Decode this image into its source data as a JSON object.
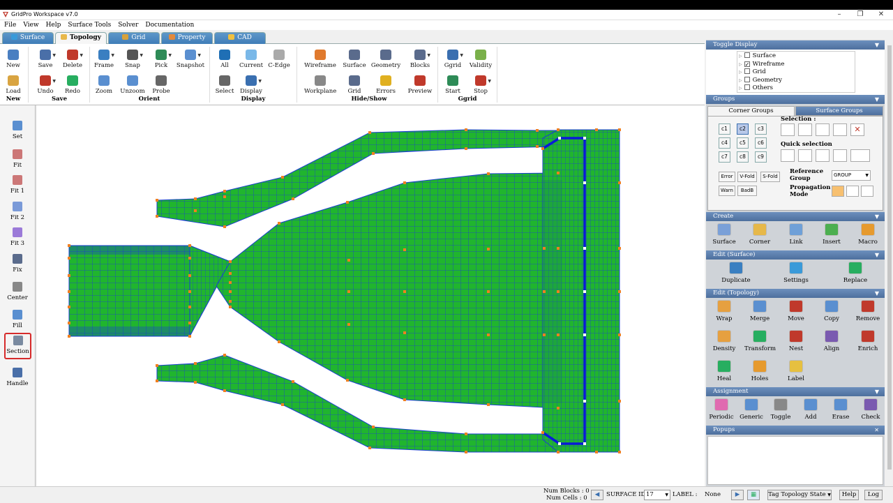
{
  "window": {
    "title": "GridPro Workspace v7.0",
    "min": "–",
    "max": "❐",
    "close": "✕"
  },
  "menu": [
    "File",
    "View",
    "Help",
    "Surface Tools",
    "Solver",
    "Documentation"
  ],
  "tabs": [
    {
      "label": "Surface",
      "color": "#3a9ad9"
    },
    {
      "label": "Topology",
      "color": "#e8b84a"
    },
    {
      "label": "Grid",
      "color": "#d9a23a"
    },
    {
      "label": "Property",
      "color": "#e2893c"
    },
    {
      "label": "CAD",
      "color": "#f0c040"
    }
  ],
  "ribbon": {
    "buttons": [
      {
        "label": "New",
        "color": "#4a7fc1"
      },
      {
        "label": "Save",
        "color": "#4a6fa8"
      },
      {
        "label": "Delete",
        "color": "#c0392b"
      },
      {
        "label": "Load",
        "color": "#d9a441"
      },
      {
        "label": "Undo",
        "color": "#c0392b"
      },
      {
        "label": "Redo",
        "color": "#27ae60"
      },
      {
        "label": "Frame",
        "color": "#3a7fc1"
      },
      {
        "label": "Snap",
        "color": "#555"
      },
      {
        "label": "Pick",
        "color": "#2e8b57"
      },
      {
        "label": "Snapshot",
        "color": "#5a8fd0"
      },
      {
        "label": "Zoom",
        "color": "#5a8fd0"
      },
      {
        "label": "Unzoom",
        "color": "#5a8fd0"
      },
      {
        "label": "Probe",
        "color": "#666"
      },
      {
        "label": "All",
        "color": "#1f6fb5"
      },
      {
        "label": "Current",
        "color": "#7ab8e8"
      },
      {
        "label": "C-Edge",
        "color": "#aaa"
      },
      {
        "label": "Select",
        "color": "#666"
      },
      {
        "label": "Display",
        "color": "#3a6fb0"
      },
      {
        "label": "Wireframe",
        "color": "#e07a2e"
      },
      {
        "label": "Surface",
        "color": "#5a6b8c"
      },
      {
        "label": "Geometry",
        "color": "#5a6b8c"
      },
      {
        "label": "Blocks",
        "color": "#5a6b8c"
      },
      {
        "label": "Workplane",
        "color": "#888"
      },
      {
        "label": "Grid",
        "color": "#5a6b8c"
      },
      {
        "label": "Errors",
        "color": "#e0b020"
      },
      {
        "label": "Preview",
        "color": "#c0392b"
      },
      {
        "label": "Ggrid",
        "color": "#3a6fb0"
      },
      {
        "label": "Validity",
        "color": "#7ab04a"
      },
      {
        "label": "Start",
        "color": "#2e8b57"
      },
      {
        "label": "Stop",
        "color": "#c0392b"
      }
    ],
    "groups": [
      "New",
      "Save",
      "Orient",
      "Display",
      "Hide/Show",
      "Ggrid"
    ]
  },
  "left_toolbar": [
    {
      "label": "Set"
    },
    {
      "label": "Fit"
    },
    {
      "label": "Fit 1"
    },
    {
      "label": "Fit 2"
    },
    {
      "label": "Fit 3"
    },
    {
      "label": "Fix"
    },
    {
      "label": "Center"
    },
    {
      "label": "Fill"
    },
    {
      "label": "Section"
    },
    {
      "label": "Handle"
    }
  ],
  "right_panel": {
    "toggle_display": {
      "title": "Toggle Display",
      "items": [
        {
          "label": "Surface",
          "checked": false
        },
        {
          "label": "Wireframe",
          "checked": true
        },
        {
          "label": "Grid",
          "checked": false
        },
        {
          "label": "Geometry",
          "checked": false
        },
        {
          "label": "Others",
          "checked": false
        }
      ]
    },
    "groups": {
      "title": "Groups",
      "tab_corner": "Corner Groups",
      "tab_surface": "Surface Groups",
      "corner_buttons": [
        "c1",
        "c2",
        "c3",
        "c4",
        "c5",
        "c6",
        "c7",
        "c8",
        "c9"
      ],
      "selected": "c2",
      "selection_label": "Selection :",
      "quick_label": "Quick selection",
      "filters": [
        "Error",
        "V-Fold",
        "S-Fold",
        "Warn",
        "BadB"
      ],
      "ref_group_label": "Reference Group",
      "ref_group_value": "GROUP",
      "prop_mode_label": "Propagation Mode"
    },
    "create": {
      "title": "Create",
      "items": [
        {
          "label": "Surface",
          "color": "#7aa0d8"
        },
        {
          "label": "Corner",
          "color": "#e6b84a"
        },
        {
          "label": "Link",
          "color": "#6fa0d8"
        },
        {
          "label": "Insert",
          "color": "#4caf50"
        },
        {
          "label": "Macro",
          "color": "#e69a2e"
        }
      ]
    },
    "edit_surface": {
      "title": "Edit (Surface)",
      "items": [
        {
          "label": "Duplicate",
          "color": "#3a7fc1"
        },
        {
          "label": "Settings",
          "color": "#3a9ad9"
        },
        {
          "label": "Replace",
          "color": "#27ae60"
        }
      ]
    },
    "edit_topology": {
      "title": "Edit (Topology)",
      "items": [
        {
          "label": "Wrap",
          "color": "#e6a040"
        },
        {
          "label": "Merge",
          "color": "#5a8fd0"
        },
        {
          "label": "Move",
          "color": "#c0392b"
        },
        {
          "label": "Copy",
          "color": "#5a8fd0"
        },
        {
          "label": "Remove",
          "color": "#c0392b"
        },
        {
          "label": "Density",
          "color": "#e6a040"
        },
        {
          "label": "Transform",
          "color": "#27ae60"
        },
        {
          "label": "Nest",
          "color": "#c0392b"
        },
        {
          "label": "Align",
          "color": "#7a5ab0"
        },
        {
          "label": "Enrich",
          "color": "#c0392b"
        },
        {
          "label": "Heal",
          "color": "#27ae60"
        },
        {
          "label": "Holes",
          "color": "#e69a2e"
        },
        {
          "label": "Label",
          "color": "#e6c040"
        }
      ]
    },
    "assignment": {
      "title": "Assignment",
      "items": [
        {
          "label": "Periodic",
          "color": "#e06ab0"
        },
        {
          "label": "Generic",
          "color": "#5a8fd0"
        },
        {
          "label": "Toggle",
          "color": "#888"
        },
        {
          "label": "Add",
          "color": "#5a8fd0"
        },
        {
          "label": "Erase",
          "color": "#5a8fd0"
        },
        {
          "label": "Check",
          "color": "#7a5ab0"
        }
      ]
    },
    "popups": {
      "title": "Popups",
      "close": "✕"
    }
  },
  "statusbar": {
    "num_blocks": "Num Blocks : 0",
    "num_cells": "Num Cells : 0",
    "surface_id_label": "SURFACE ID :",
    "surface_id_value": "17",
    "label_label": "LABEL :",
    "label_value": "None",
    "tag_state": "Tag Topology State",
    "help": "Help",
    "log": "Log"
  },
  "colors": {
    "mesh_fill": "#20b52e",
    "mesh_line": "#1a3fd0",
    "corner": "#f08020",
    "highlight": "#0a1ad8"
  }
}
